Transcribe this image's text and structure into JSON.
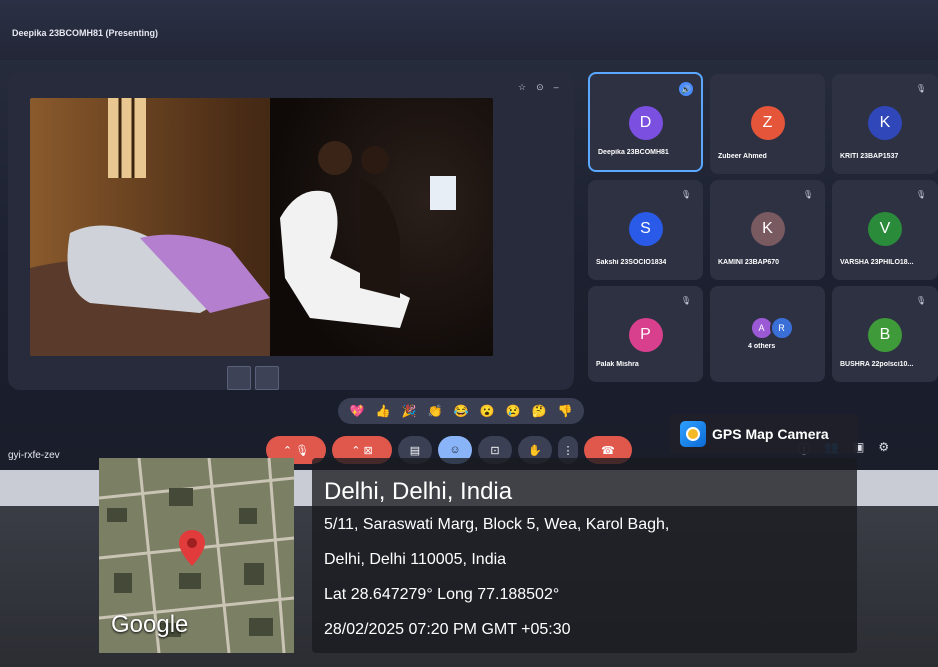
{
  "meeting": {
    "presenter_title": "Deepika 23BCOMH81 (Presenting)",
    "meet_code": "gyi-rxfe-zev"
  },
  "participants": [
    {
      "name": "Deepika 23BCOMH81",
      "initial": "D",
      "color": "#7b4fe0"
    },
    {
      "name": "Zubeer Ahmed",
      "initial": "Z",
      "color": "#e4553a"
    },
    {
      "name": "KRITI 23BAP1537",
      "initial": "K",
      "color": "#2f47b8"
    },
    {
      "name": "Sakshi 23SOCIO1834",
      "initial": "S",
      "color": "#2a5be8"
    },
    {
      "name": "KAMINI 23BAP670",
      "initial": "K",
      "color": "#7a5a61"
    },
    {
      "name": "VARSHA 23PHILO18...",
      "initial": "V",
      "color": "#2a8b3a"
    },
    {
      "name": "Palak Mishra",
      "initial": "P",
      "color": "#d8408e"
    },
    {
      "name": "4 others",
      "initial_a": "A",
      "initial_b": "R",
      "color_a": "#9b59d6",
      "color_b": "#3a6fd8"
    },
    {
      "name": "BUSHRA 22polsci10...",
      "initial": "B",
      "color": "#3f9a3a"
    }
  ],
  "reactions": [
    "💖",
    "👍",
    "🎉",
    "👏",
    "😂",
    "😮",
    "😢",
    "🤔",
    "👎"
  ],
  "gps": {
    "app_name": "GPS Map Camera",
    "map_label": "Google",
    "location_title": "Delhi, Delhi, India",
    "address_line1": "5/11, Saraswati Marg, Block 5, Wea, Karol Bagh,",
    "address_line2": "Delhi, Delhi 110005, India",
    "coords": "Lat 28.647279° Long 77.188502°",
    "datetime": "28/02/2025 07:20 PM GMT +05:30"
  }
}
